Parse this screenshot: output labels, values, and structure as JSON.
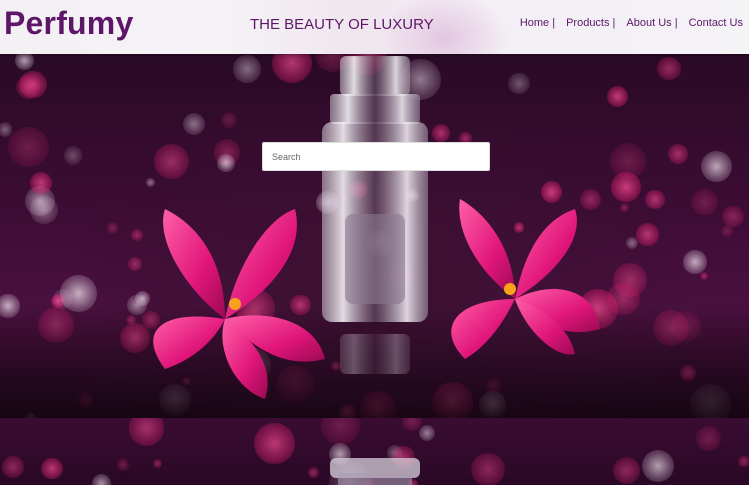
{
  "header": {
    "logo": "Perfumy",
    "tagline": "THE BEAUTY OF LUXURY",
    "nav": [
      {
        "label": "Home |"
      },
      {
        "label": "Products |"
      },
      {
        "label": "About Us |"
      },
      {
        "label": "Contact Us"
      }
    ]
  },
  "hero": {
    "search": {
      "placeholder": "Search",
      "value": ""
    },
    "image_subject": "perfume-bottle-with-pink-lilies"
  },
  "colors": {
    "brand": "#5e1668",
    "header_bg": "#f3f1f4",
    "bokeh_pink": "#ff3a8c",
    "petal_pink": "#e8187a"
  }
}
